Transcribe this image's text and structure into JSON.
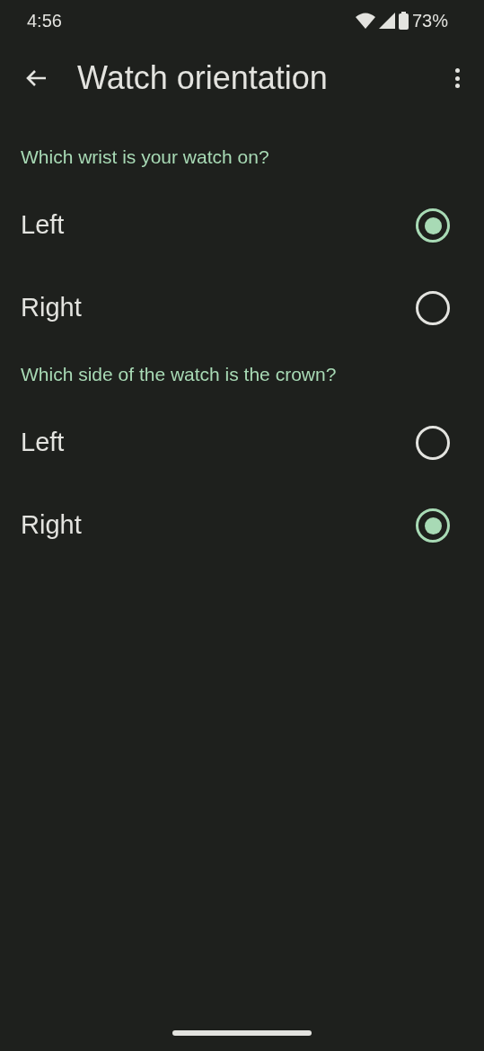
{
  "status_bar": {
    "time": "4:56",
    "battery": "73%"
  },
  "app_bar": {
    "title": "Watch orientation"
  },
  "sections": [
    {
      "title": "Which wrist is your watch on?",
      "options": [
        {
          "label": "Left",
          "selected": true
        },
        {
          "label": "Right",
          "selected": false
        }
      ]
    },
    {
      "title": "Which side of the watch is the crown?",
      "options": [
        {
          "label": "Left",
          "selected": false
        },
        {
          "label": "Right",
          "selected": true
        }
      ]
    }
  ]
}
